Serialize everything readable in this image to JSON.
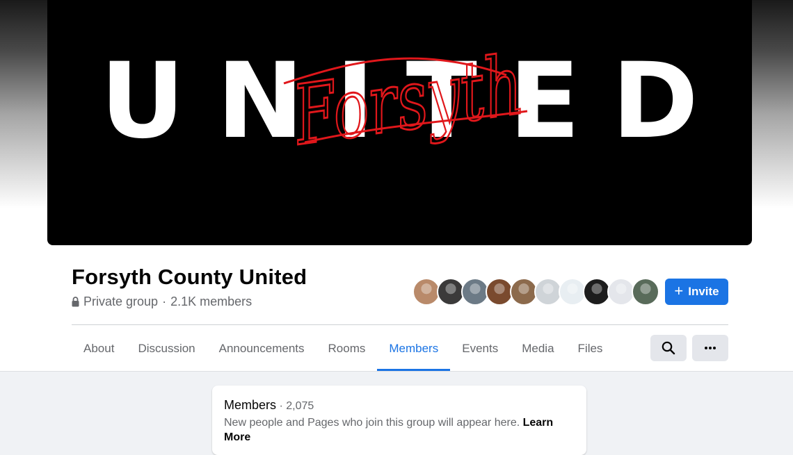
{
  "cover": {
    "word": "UNITED",
    "script_word": "Forsyth"
  },
  "group": {
    "name": "Forsyth County United",
    "privacy": "Private group",
    "separator": "·",
    "member_count": "2.1K members"
  },
  "avatars": [
    {
      "name": "member-avatar-1",
      "color": "#b98a6a"
    },
    {
      "name": "member-avatar-2",
      "color": "#3b3a3a"
    },
    {
      "name": "member-avatar-3",
      "color": "#6c7a86"
    },
    {
      "name": "member-avatar-4",
      "color": "#7a4a2e"
    },
    {
      "name": "member-avatar-5",
      "color": "#8c6a4c"
    },
    {
      "name": "member-avatar-6",
      "color": "#cfd4d8"
    },
    {
      "name": "member-avatar-7",
      "color": "#e8eef2"
    },
    {
      "name": "member-avatar-8",
      "color": "#1d1d1d"
    },
    {
      "name": "member-avatar-9",
      "color": "#e4e6eb"
    },
    {
      "name": "member-avatar-10",
      "color": "#596b5a"
    }
  ],
  "actions": {
    "invite_label": "Invite"
  },
  "tabs": [
    {
      "label": "About",
      "active": false
    },
    {
      "label": "Discussion",
      "active": false
    },
    {
      "label": "Announcements",
      "active": false
    },
    {
      "label": "Rooms",
      "active": false
    },
    {
      "label": "Members",
      "active": true
    },
    {
      "label": "Events",
      "active": false
    },
    {
      "label": "Media",
      "active": false
    },
    {
      "label": "Files",
      "active": false
    }
  ],
  "icons": {
    "search": "search-icon",
    "more": "more-icon",
    "lock": "lock-icon",
    "plus": "plus-icon"
  },
  "members_card": {
    "title": "Members",
    "separator": " · ",
    "count": "2,075",
    "description": "New people and Pages who join this group will appear here.",
    "learn_more": "Learn More"
  },
  "colors": {
    "accent": "#1b74e4",
    "script_red": "#e0171b",
    "text_secondary": "#65676b"
  }
}
